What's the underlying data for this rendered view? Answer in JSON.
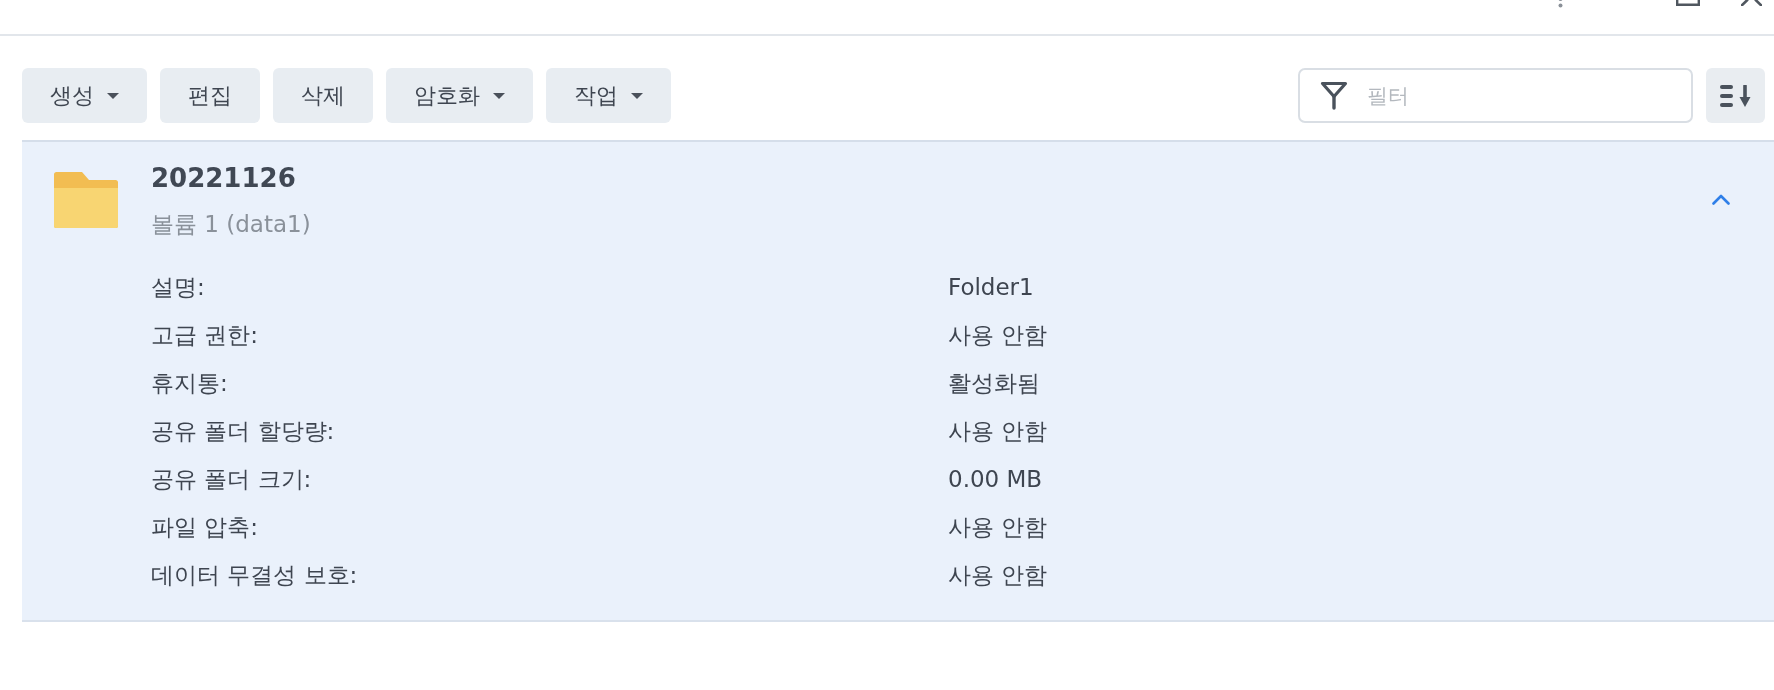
{
  "toolbar": {
    "buttons": [
      {
        "label": "생성",
        "dropdown": true
      },
      {
        "label": "편집",
        "dropdown": false
      },
      {
        "label": "삭제",
        "dropdown": false
      },
      {
        "label": "암호화",
        "dropdown": true
      },
      {
        "label": "작업",
        "dropdown": true
      }
    ]
  },
  "filter": {
    "placeholder": "필터"
  },
  "folders": [
    {
      "name": "20221126",
      "location": "볼륨 1 (data1)",
      "selected": true,
      "expanded": true,
      "details": [
        {
          "label": "설명:",
          "value": "Folder1"
        },
        {
          "label": "고급 권한:",
          "value": "사용 안함"
        },
        {
          "label": "휴지통:",
          "value": "활성화됨"
        },
        {
          "label": "공유 폴더 할당량:",
          "value": "사용 안함"
        },
        {
          "label": "공유 폴더 크기:",
          "value": "0.00 MB"
        },
        {
          "label": "파일 압축:",
          "value": "사용 안함"
        },
        {
          "label": "데이터 무결성 보호:",
          "value": "사용 안함"
        }
      ]
    }
  ]
}
